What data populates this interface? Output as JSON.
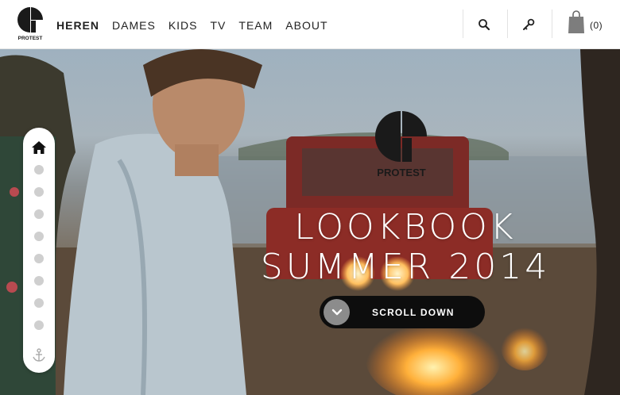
{
  "brand": {
    "logo_text": "PROTEST",
    "logo_icon": "protest-logo-icon"
  },
  "nav": [
    {
      "label": "HEREN",
      "active": true
    },
    {
      "label": "DAMES",
      "active": false
    },
    {
      "label": "KIDS",
      "active": false
    },
    {
      "label": "TV",
      "active": false
    },
    {
      "label": "TEAM",
      "active": false
    },
    {
      "label": "ABOUT",
      "active": false
    }
  ],
  "header_icons": [
    "search-icon",
    "key-icon",
    "shopping-bag-icon"
  ],
  "cart": {
    "count": "(0)"
  },
  "hero": {
    "brand_text": "PROTEST",
    "headline_line1": "LOOKBOOK",
    "headline_line2": "SUMMER 2014",
    "scroll_label": "SCROLL DOWN"
  },
  "side_nav": {
    "dot_count": 9,
    "top_icon": "home-icon",
    "bottom_icon": "anchor-icon"
  },
  "colors": {
    "button_bg": "#0d0d0d",
    "button_circle": "#8c8c8c",
    "dot": "#cfcfcf"
  }
}
